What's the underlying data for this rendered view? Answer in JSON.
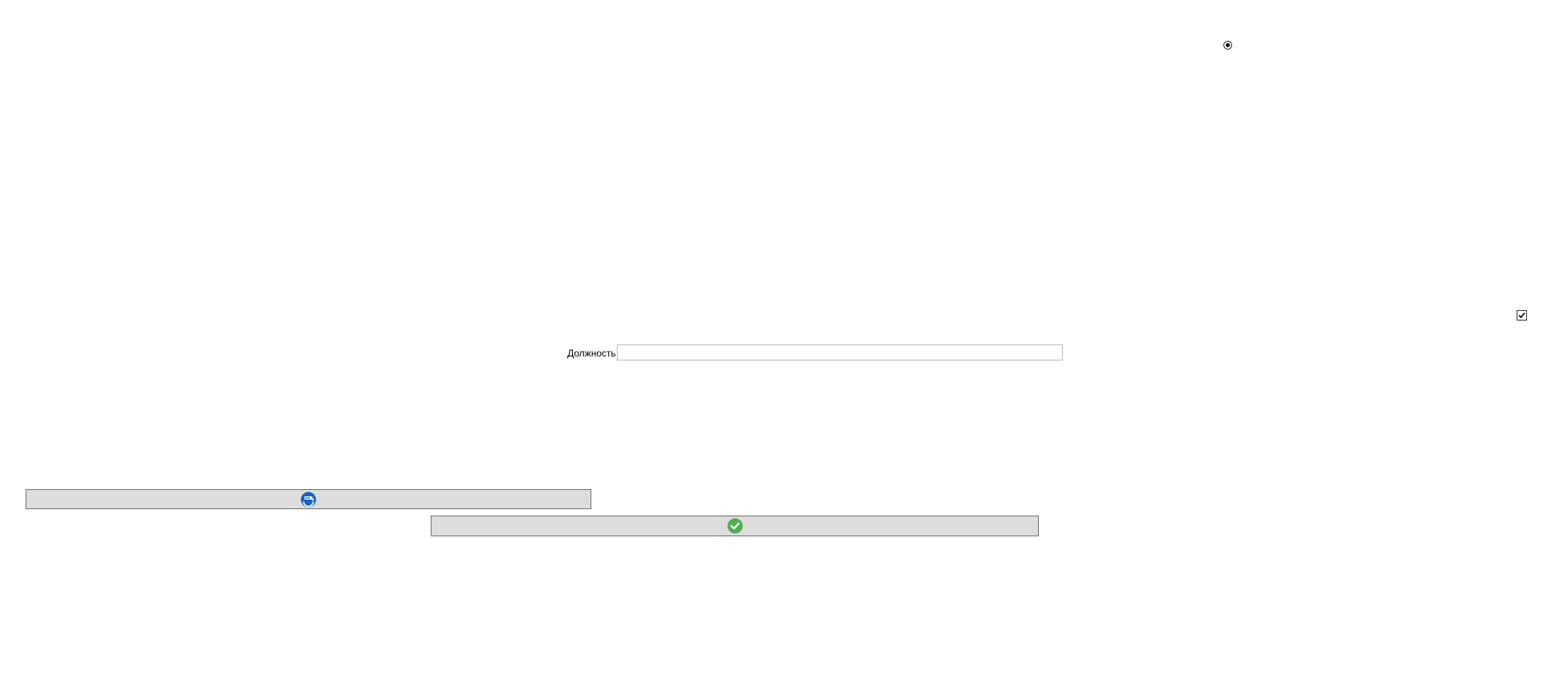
{
  "form": {
    "position_label": "Должность",
    "position_value": "",
    "radio_selected": true,
    "checkbox_checked": true
  },
  "buttons": {
    "first": {
      "icon": "person-blue-circle-icon"
    },
    "second": {
      "icon": "green-checkmark-circle-icon"
    }
  },
  "colors": {
    "button_bg": "#dddddd",
    "button_border": "#707070",
    "icon_blue": "#1565c0",
    "icon_green": "#4caf50"
  }
}
